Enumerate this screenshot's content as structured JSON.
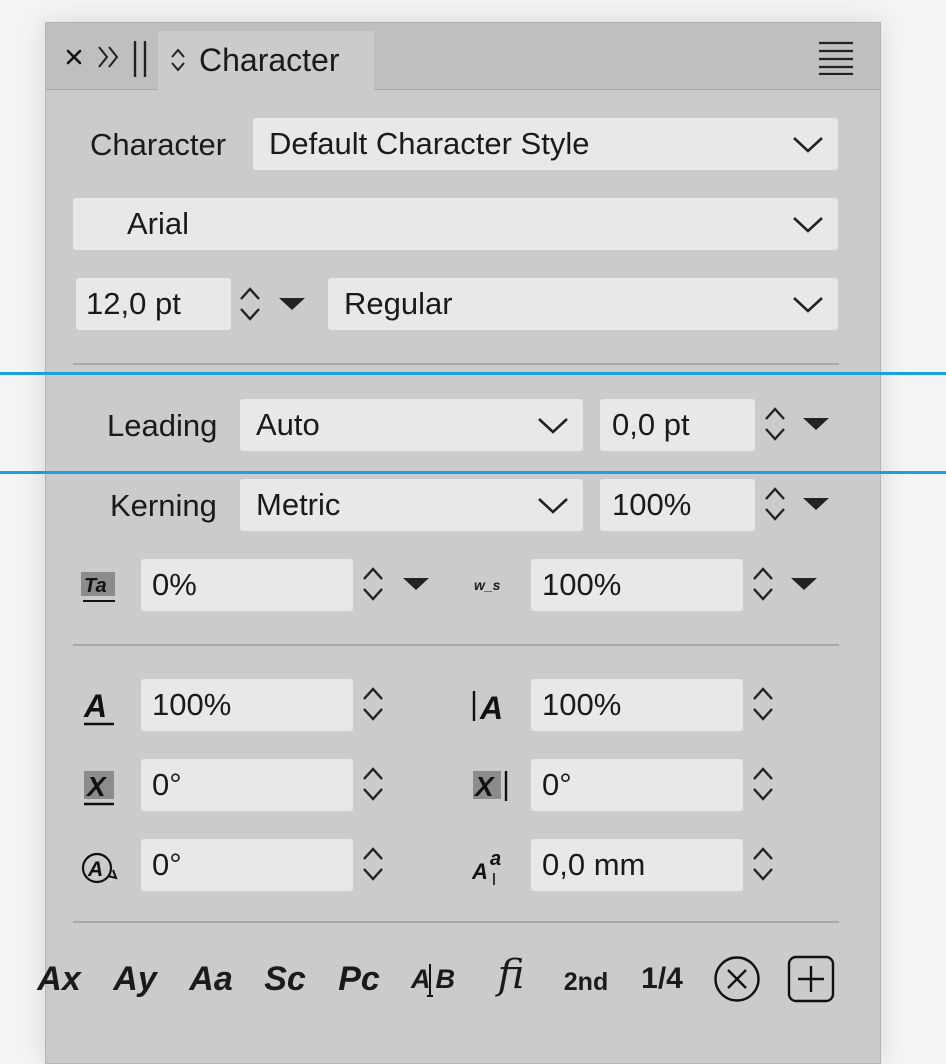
{
  "window": {
    "tab_title": "Character"
  },
  "style_row": {
    "label": "Character",
    "value": "Default Character Style"
  },
  "font": {
    "family": "Arial"
  },
  "size_row": {
    "size": "12,0 pt",
    "weight": "Regular"
  },
  "leading": {
    "label": "Leading",
    "mode": "Auto",
    "value": "0,0 pt"
  },
  "kerning": {
    "label": "Kerning",
    "mode": "Metric",
    "value": "100%"
  },
  "tracking": {
    "value": "0%"
  },
  "word_spacing": {
    "icon_label": "w_s",
    "value": "100%"
  },
  "scale": {
    "horizontal": "100%",
    "vertical": "100%"
  },
  "skew": {
    "horizontal": "0°",
    "vertical": "0°"
  },
  "rotation": {
    "value": "0°"
  },
  "baseline_shift": {
    "value": "0,0 mm"
  },
  "typography_buttons": {
    "all_caps": "Ax",
    "ascenders": "Ay",
    "title_case": "Aa",
    "small_caps": "Sc",
    "petite_caps": "Pc",
    "ligature_ab": "AB",
    "ligature_fi": "fi",
    "ordinal": "2nd",
    "fraction": "1/4"
  },
  "colors": {
    "panel_bg": "#cbcbcb",
    "field_bg": "#e8e8e8",
    "guide": "#1ba0df"
  }
}
